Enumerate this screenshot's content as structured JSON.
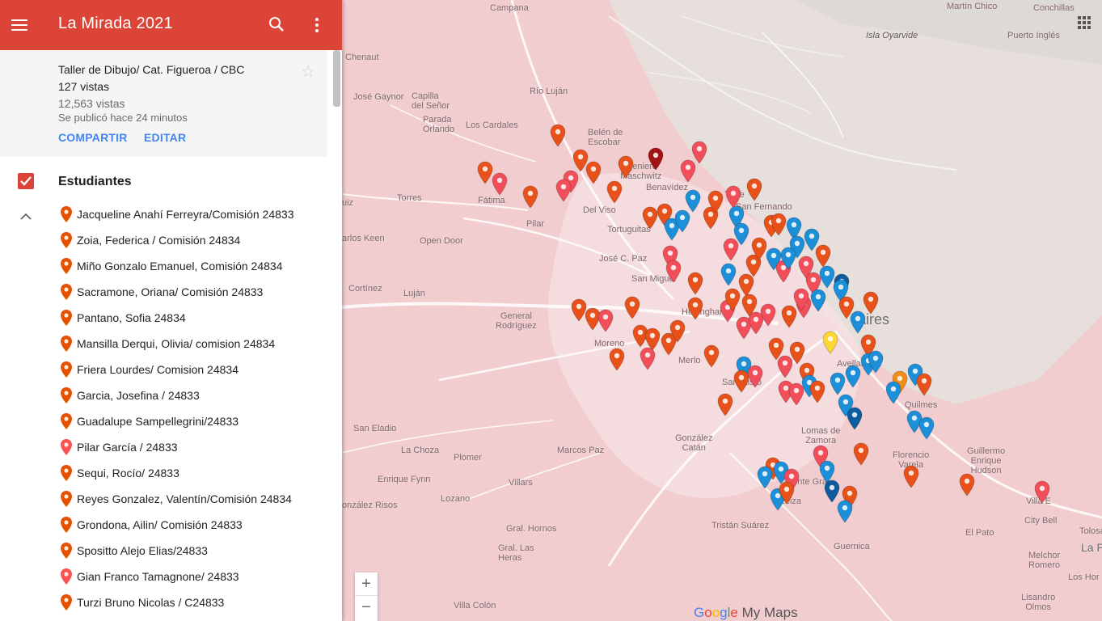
{
  "app": {
    "title": "La Mirada 2021"
  },
  "map_info": {
    "subtitle": "Taller de Dibujo/ Cat. Figueroa / CBC",
    "views_layer": "127 vistas",
    "views_total": "12,563 vistas",
    "published": "Se publicó hace 24 minutos",
    "share_label": "COMPARTIR",
    "edit_label": "EDITAR"
  },
  "layer": {
    "name": "Estudiantes",
    "checked": true
  },
  "students": [
    {
      "label": "Jacqueline Anahí Ferreyra/Comisión 24833",
      "color": "#e65100"
    },
    {
      "label": "Zoia, Federica / Comisión 24834",
      "color": "#e65100"
    },
    {
      "label": "Miño Gonzalo Emanuel, Comisión 24834",
      "color": "#e65100"
    },
    {
      "label": "Sacramone, Oriana/ Comisión 24833",
      "color": "#e65100"
    },
    {
      "label": "Pantano, Sofia 24834",
      "color": "#e65100"
    },
    {
      "label": "Mansilla Derqui, Olivia/ comision 24834",
      "color": "#e65100"
    },
    {
      "label": "Friera Lourdes/ Comision 24834",
      "color": "#e65100"
    },
    {
      "label": "Garcia, Josefina / 24833",
      "color": "#e65100"
    },
    {
      "label": "Guadalupe Sampellegrini/24833",
      "color": "#e65100"
    },
    {
      "label": "Pilar García / 24833",
      "color": "#ff5252"
    },
    {
      "label": "Sequi, Rocío/ 24833",
      "color": "#e65100"
    },
    {
      "label": "Reyes Gonzalez, Valentín/Comisión 24834",
      "color": "#e65100"
    },
    {
      "label": "Grondona, Ailin/ Comisión 24833",
      "color": "#e65100"
    },
    {
      "label": "Spositto Alejo Elias/24833",
      "color": "#e65100"
    },
    {
      "label": "Gian Franco Tamagnone/ 24833",
      "color": "#ff5252"
    },
    {
      "label": "Turzi Bruno Nicolas / C24833",
      "color": "#e65100"
    }
  ],
  "map": {
    "places": {
      "campana": "Campana",
      "martin_chico": "Martín Chico",
      "conchillas": "Conchillas",
      "isla_oyarvide": "Isla Oyarvide",
      "puerto_ingles": "Puerto Inglés",
      "chenaut": "Chenaut",
      "rio_lujan": "Río Luján",
      "capilla": "Capilla\ndel Señor",
      "parada_orlando": "Parada\nOrlando",
      "los_cardales": "Los Cardales",
      "belen": "Belén de\nEscobar",
      "jose_gaynor": "José Gaynor",
      "ingeniero": "Ingeniero\nMaschwitz",
      "benavidez": "Benavídez",
      "tigre": "Tigre",
      "san_fernando": "San Fernando",
      "fatima": "Fátima",
      "del_viso": "Del Viso",
      "torres": "Torres",
      "pilar": "Pilar",
      "tortuguitas": "Tortuguitas",
      "luiz": "uiz",
      "carlos_keen": "arlos Keen",
      "open_door": "Open Door",
      "jose_c_paz": "José C. Paz",
      "san_miguel": "San Miguel",
      "cortinez": "Cortínez",
      "lujan": "Luján",
      "general_rodriguez": "General\nRodríguez",
      "hurlingham": "Hurlingham",
      "moreno": "Moreno",
      "merlo": "Merlo",
      "aires": "Aires",
      "avellaneda": "Avellaneda",
      "san_justo": "San Justo",
      "san_eladio": "San Eladio",
      "la_choza": "La Choza",
      "marcos_paz": "Marcos Paz",
      "gonzalez_catan": "González\nCatán",
      "lomas": "Lomas de\nZamora",
      "quilmes": "Quilmes",
      "plomer": "Plomer",
      "enrique_fynn": "Enrique Fynn",
      "florencio_varela": "Florencio\nVarela",
      "guillermo_hudson": "Guillermo\nEnrique\nHudson",
      "gonzalez_risos": "onzález Risos",
      "lozano": "Lozano",
      "villars": "Villars",
      "monte_grande": "Monte Gra",
      "ezeiza": "Ezeiza",
      "villa_elisa": "Villa E",
      "city_bell": "City Bell",
      "tolosa": "Tolosa",
      "gral_hornos": "Gral. Hornos",
      "tristan_suarez": "Tristán Suárez",
      "el_pato": "El Pato",
      "guernica": "Guernica",
      "gral_las_heras": "Gral. Las\nHeras",
      "melchor_romero": "Melchor\nRomero",
      "la_p": "La P",
      "los_hornos": "Los Hor",
      "lisandro_olmos": "Lisandro\nOlmos",
      "villa_colon": "Villa Colón"
    },
    "zoom_in": "+",
    "zoom_out": "−",
    "brand_google": "Google",
    "brand_mymaps": " My Maps"
  }
}
